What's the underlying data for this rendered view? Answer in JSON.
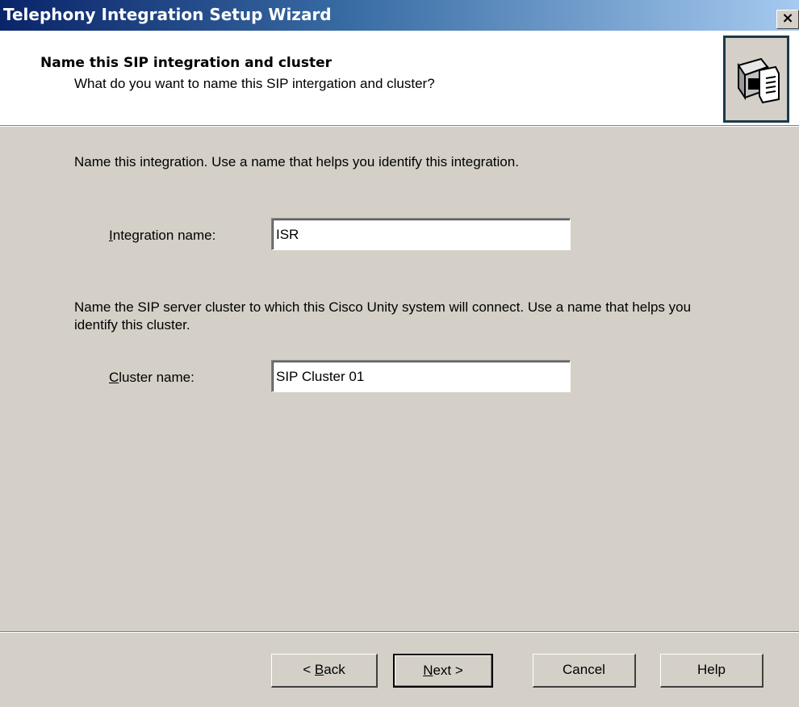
{
  "window": {
    "title": "Telephony Integration Setup Wizard",
    "close_label": "×"
  },
  "header": {
    "title": "Name this SIP integration and cluster",
    "subtitle": "What do you want to name this SIP intergation and cluster?",
    "icon": "wizard-computer-icon"
  },
  "body": {
    "intro": "Name this integration. Use a name that helps you identify this integration.",
    "integration_label_mnemonic": "I",
    "integration_label_rest": "ntegration name:",
    "integration_value": "ISR",
    "cluster_intro": "Name the SIP server cluster to which this Cisco Unity system will connect. Use a name that helps you identify this cluster.",
    "cluster_label_mnemonic": "C",
    "cluster_label_rest": "luster name:",
    "cluster_value": "SIP Cluster 01"
  },
  "buttons": {
    "back_prefix": "< ",
    "back_mnemonic": "B",
    "back_rest": "ack",
    "next_mnemonic": "N",
    "next_rest": "ext >",
    "cancel": "Cancel",
    "help": "Help"
  },
  "colors": {
    "dialog_face": "#d4d0c8",
    "title_gradient_start": "#0a246a",
    "title_gradient_end": "#a6caf0"
  }
}
